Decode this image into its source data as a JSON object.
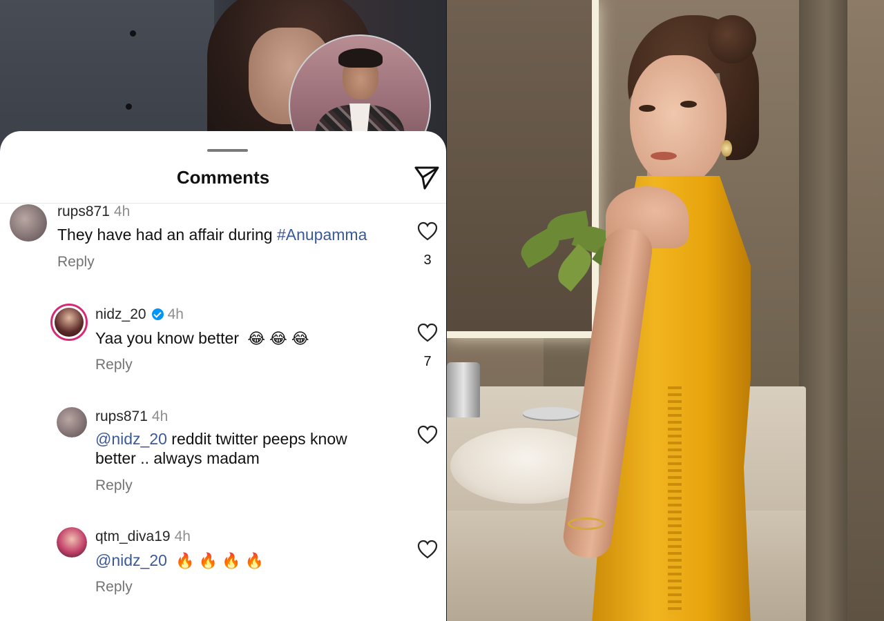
{
  "comments_sheet": {
    "title": "Comments",
    "comments": [
      {
        "username": "rups871",
        "time": "4h",
        "text": "They have had an affair during ",
        "hashtag": "#Anupamma",
        "reply_label": "Reply",
        "likes": "3",
        "verified": false
      },
      {
        "username": "nidz_20",
        "time": "4h",
        "text": "Yaa you know better",
        "emoji": [
          "😂",
          "😂",
          "😂"
        ],
        "reply_label": "Reply",
        "likes": "7",
        "verified": true
      },
      {
        "username": "rups871",
        "time": "4h",
        "mention": "@nidz_20",
        "text": " reddit twitter peeps know better .. always madam",
        "reply_label": "Reply",
        "verified": false
      },
      {
        "username": "qtm_diva19",
        "time": "4h",
        "mention": "@nidz_20",
        "emoji": [
          "🔥",
          "🔥",
          "🔥",
          "🔥"
        ],
        "reply_label": "Reply",
        "verified": false
      }
    ]
  },
  "icons": {
    "share": "paper-plane-icon",
    "like": "heart-outline-icon",
    "verified": "verified-badge-icon"
  },
  "colors": {
    "link": "#3b5998",
    "verified": "#0095f6",
    "story_ring": "#d62976",
    "dress": "#f1b520"
  }
}
